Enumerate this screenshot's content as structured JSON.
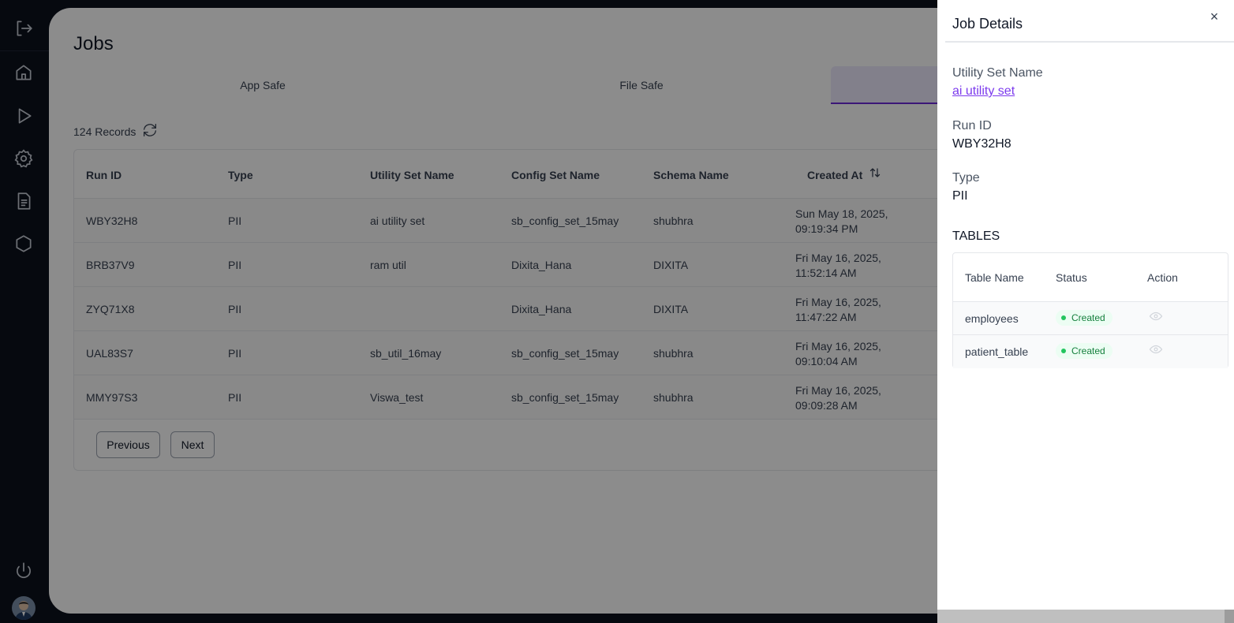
{
  "rail": {
    "icons": [
      "logout-icon",
      "home-icon",
      "play-icon",
      "settings-icon",
      "document-icon",
      "hexagon-icon",
      "power-icon"
    ]
  },
  "page": {
    "title": "Jobs",
    "tabs": [
      "App Safe",
      "File Safe",
      ""
    ],
    "records": "124 Records"
  },
  "table": {
    "headers": [
      "Run ID",
      "Type",
      "Utility Set Name",
      "Config Set Name",
      "Schema Name",
      "Created At"
    ],
    "rows": [
      {
        "run_id": "WBY32H8",
        "type": "PII",
        "utility": "ai utility set",
        "config": "sb_config_set_15may",
        "schema": "shubhra",
        "created_1": "Sun May 18, 2025,",
        "created_2": "09:19:34 PM"
      },
      {
        "run_id": "BRB37V9",
        "type": "PII",
        "utility": "ram util",
        "config": "Dixita_Hana",
        "schema": "DIXITA",
        "created_1": "Fri May 16, 2025,",
        "created_2": "11:52:14 AM"
      },
      {
        "run_id": "ZYQ71X8",
        "type": "PII",
        "utility": "",
        "config": "Dixita_Hana",
        "schema": "DIXITA",
        "created_1": "Fri May 16, 2025,",
        "created_2": "11:47:22 AM"
      },
      {
        "run_id": "UAL83S7",
        "type": "PII",
        "utility": "sb_util_16may",
        "config": "sb_config_set_15may",
        "schema": "shubhra",
        "created_1": "Fri May 16, 2025,",
        "created_2": "09:10:04 AM"
      },
      {
        "run_id": "MMY97S3",
        "type": "PII",
        "utility": "Viswa_test",
        "config": "sb_config_set_15may",
        "schema": "shubhra",
        "created_1": "Fri May 16, 2025,",
        "created_2": "09:09:28 AM"
      }
    ],
    "previous_label": "Previous",
    "next_label": "Next"
  },
  "drawer": {
    "title": "Job Details",
    "close": "×",
    "utility_label": "Utility Set Name",
    "utility_value": "ai utility set",
    "run_label": "Run ID",
    "run_value": "WBY32H8",
    "type_label": "Type",
    "type_value": "PII",
    "tables_heading": "TABLES",
    "table_headers": [
      "Table Name",
      "Status",
      "Action"
    ],
    "tables": [
      {
        "name": "employees",
        "status": "Created"
      },
      {
        "name": "patient_table",
        "status": "Created"
      }
    ]
  },
  "colors": {
    "rail": "#0c111d",
    "accent": "#7c3aed",
    "status_green": "#22c55e"
  }
}
